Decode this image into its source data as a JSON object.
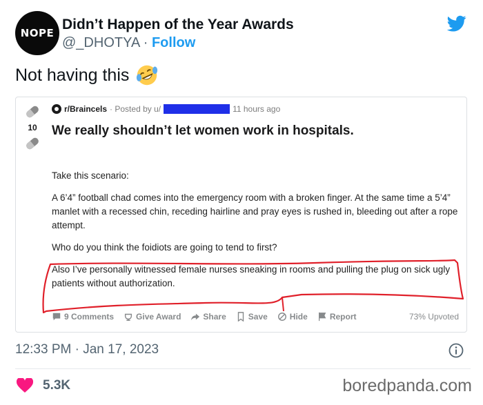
{
  "tweet": {
    "avatar_text": "NOPE",
    "display_name": "Didn’t Happen of the Year Awards",
    "handle": "@_DHOTYA",
    "separator": " · ",
    "follow_label": "Follow",
    "text": "Not having this",
    "emoji": "rolling-on-floor-laughing",
    "timestamp": "12:33 PM · Jan 17, 2023",
    "likes": "5.3K"
  },
  "embedded_post": {
    "score": "10",
    "subreddit": "r/Braincels",
    "posted_by": "· Posted by u/",
    "time_ago": "11 hours ago",
    "title": "We really shouldn’t let women work in hospitals.",
    "paragraphs": [
      "Take this scenario:",
      "A 6’4” football chad comes into the emergency room with a broken finger. At the same time a 5’4” manlet with a recessed chin, receding hairline and pray eyes is rushed in, bleeding out after a rope attempt.",
      "Who do you think the foidiots are going to tend to first?",
      "Also I’ve personally witnessed female nurses sneaking in rooms and pulling the plug on sick ugly patients without authorization."
    ],
    "actions": {
      "comments": "9 Comments",
      "award": "Give Award",
      "share": "Share",
      "save": "Save",
      "hide": "Hide",
      "report": "Report"
    },
    "upvoted": "73% Upvoted"
  },
  "watermark": "boredpanda.com",
  "colors": {
    "twitter_blue": "#1d9bf0",
    "like_pink": "#f91880",
    "redaction_blue": "#1f2fe8",
    "annotation_red": "#e0202a"
  }
}
